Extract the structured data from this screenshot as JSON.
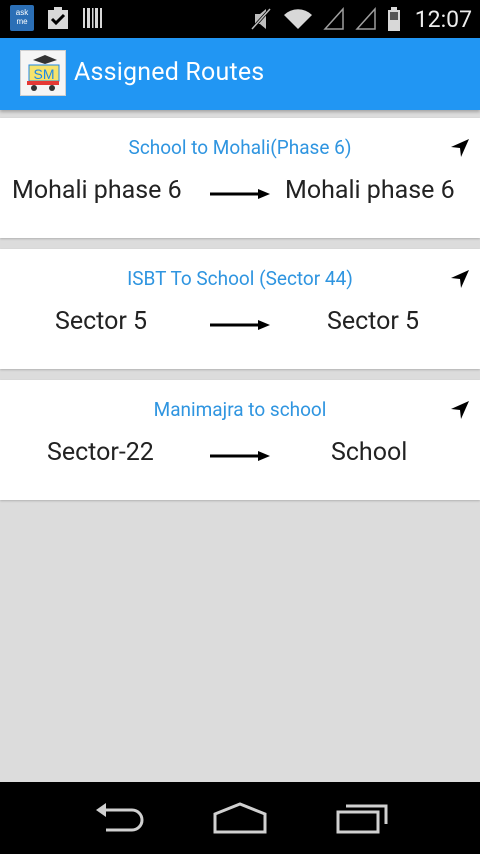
{
  "status_bar": {
    "time": "12:07",
    "notification_icons": [
      "askme-icon",
      "clipboard-check-icon",
      "barcode-icon"
    ],
    "status_icons": [
      "mute-icon",
      "wifi-icon",
      "signal-icon",
      "signal-icon",
      "battery-icon"
    ]
  },
  "app_bar": {
    "logo_text": "SM",
    "title": "Assigned Routes",
    "color": "#2196f3"
  },
  "routes": [
    {
      "title": "School to Mohali(Phase 6)",
      "from": "Mohali phase 6",
      "to": "Mohali phase 6"
    },
    {
      "title": "ISBT To School (Sector 44)",
      "from": "Sector 5",
      "to": "Sector 5"
    },
    {
      "title": "Manimajra to school",
      "from": "Sector-22",
      "to": "School"
    }
  ],
  "navigation_bar": {
    "buttons": [
      "back-icon",
      "home-icon",
      "recents-icon"
    ]
  }
}
